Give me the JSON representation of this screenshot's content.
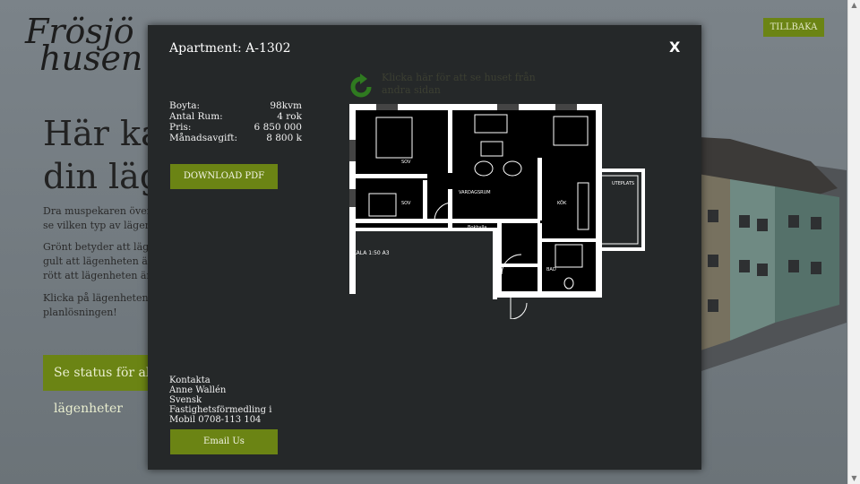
{
  "background": {
    "logo_line1": "Frösjö",
    "logo_line2": "husen",
    "back_label": "TILLBAKA",
    "hero_title": "Här kan du hitta din lägenhet",
    "paragraphs": [
      "Dra muspekaren över fasaden för att se vilken typ av lägenhet det är.",
      "Grönt betyder att lägenheten är ledig, gult att lägenheten är reserverad och rött att lägenheten är såld.",
      "Klicka på lägenheten för att se planlösningen!"
    ],
    "status_button": "Se status för alla lägenheter"
  },
  "modal": {
    "title": "Apartment: A-1302",
    "close_label": "X",
    "flip_text": "Klicka här för att se huset från andra sidan",
    "facts": [
      {
        "label": "Boyta:",
        "value": "98kvm"
      },
      {
        "label": "Antal Rum:",
        "value": "4 rok"
      },
      {
        "label": "Pris:",
        "value": "6 850 000"
      },
      {
        "label": "Månadsavgift:",
        "value": "8 800 k"
      }
    ],
    "download_label": "DOWNLOAD PDF",
    "contact": {
      "heading": "Kontakta",
      "name": "Anne Wallén",
      "company": "Svensk Fastighetsförmedling i",
      "phone": "Mobil 0708-113 104"
    },
    "email_label": "Email Us"
  },
  "floorplan": {
    "rooms": {
      "sov1": "SOV",
      "sov2": "SOV",
      "vardagsrum": "VARDAGSRUM",
      "kok": "KÖK",
      "bad": "BAD",
      "uteplats": "UTEPLATS",
      "bokhylla": "Bokhylla"
    },
    "scale": "SKALA 1:50  A3"
  },
  "colors": {
    "accent": "#6b8414",
    "modal_bg": "#252829",
    "flip_icon": "#2f7a20"
  }
}
